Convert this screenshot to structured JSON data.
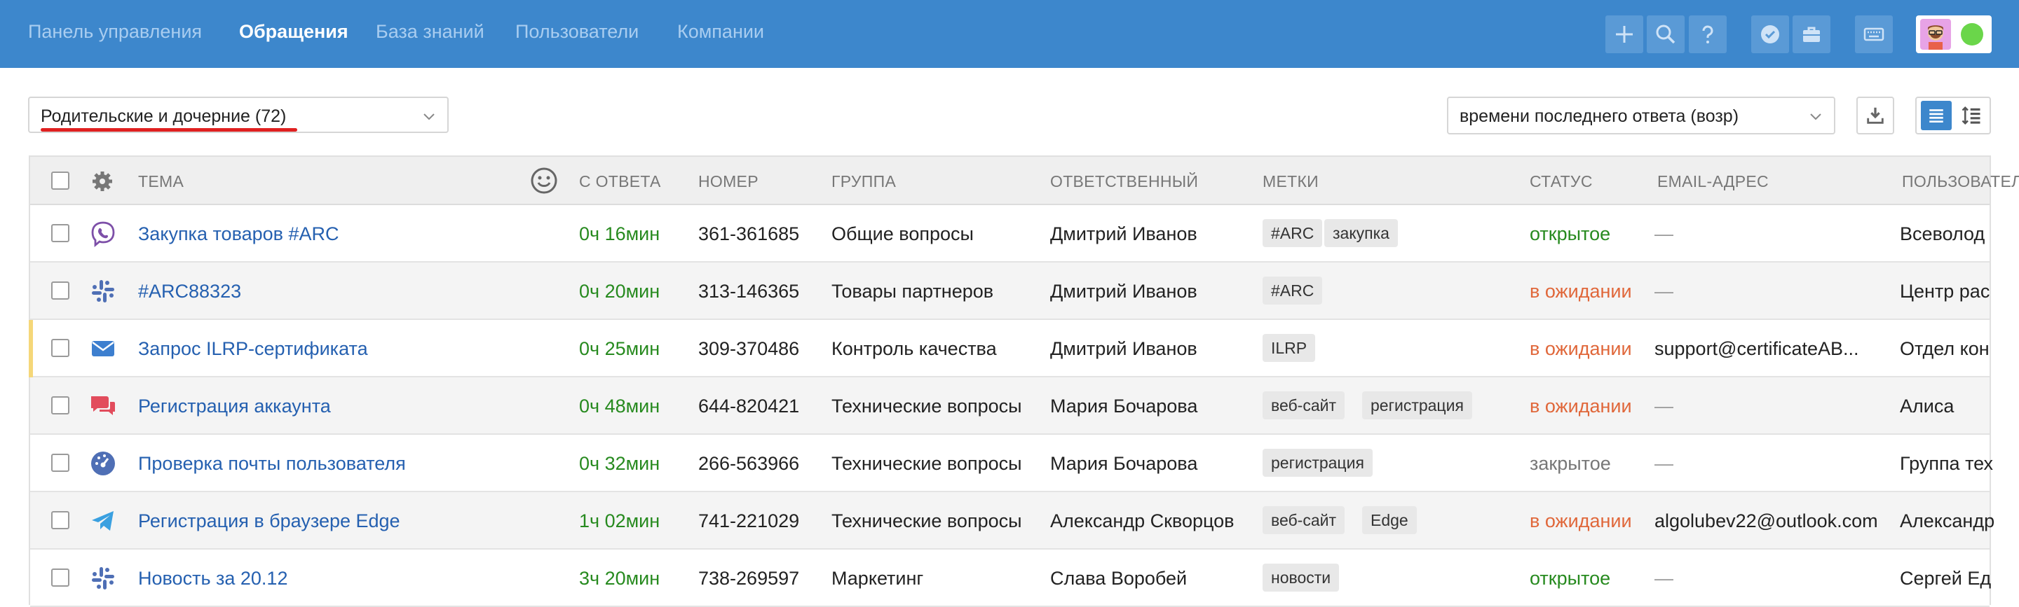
{
  "nav": {
    "items": [
      "Панель управления",
      "Обращения",
      "База знаний",
      "Пользователи",
      "Компании"
    ],
    "active": "Обращения",
    "toolbar_icons": [
      "plus-icon",
      "search-icon",
      "help-icon",
      "check-badge-icon",
      "briefcase-icon",
      "keyboard-icon"
    ]
  },
  "filter": {
    "view_select": "Родительские и дочерние (72)",
    "sort_select": "времени последнего ответа (возр)"
  },
  "table": {
    "headers": {
      "subject": "ТЕМА",
      "since_reply": "С ОТВЕТА",
      "number": "НОМЕР",
      "group": "ГРУППА",
      "assignee": "ОТВЕТСТВЕННЫЙ",
      "tags": "МЕТКИ",
      "status": "СТАТУС",
      "email": "EMAIL-АДРЕС",
      "user": "ПОЛЬЗОВАТЕЛЬ"
    },
    "rows": [
      {
        "channel": "viber-icon",
        "subject": "Закупка товаров #ARC",
        "since_reply": "0ч 16мин",
        "number": "361-361685",
        "group": "Общие вопросы",
        "assignee": "Дмитрий Иванов",
        "tags": [
          "#ARC",
          "закупка"
        ],
        "status": "открытое",
        "status_kind": "open",
        "email": "—",
        "user": "Всеволод"
      },
      {
        "channel": "slack-icon",
        "subject": "#ARC88323",
        "since_reply": "0ч 20мин",
        "number": "313-146365",
        "group": "Товары партнеров",
        "assignee": "Дмитрий Иванов",
        "tags": [
          "#ARC"
        ],
        "status": "в ожидании",
        "status_kind": "wait",
        "email": "—",
        "user": "Центр рас"
      },
      {
        "channel": "email-icon",
        "subject": "Запрос ILRP-сертификата",
        "since_reply": "0ч 25мин",
        "number": "309-370486",
        "group": "Контроль качества",
        "assignee": "Дмитрий Иванов",
        "tags": [
          "ILRP"
        ],
        "status": "в ожидании",
        "status_kind": "wait",
        "email": "support@certificateAB...",
        "user": "Отдел кон"
      },
      {
        "channel": "chat-icon",
        "subject": "Регистрация аккаунта",
        "since_reply": "0ч 48мин",
        "number": "644-820421",
        "group": "Технические вопросы",
        "assignee": "Мария Бочарова",
        "tags": [
          "веб-сайт",
          "регистрация"
        ],
        "status": "в ожидании",
        "status_kind": "wait",
        "email": "—",
        "user": "Алиса"
      },
      {
        "channel": "dashboard-icon",
        "subject": "Проверка почты пользователя",
        "since_reply": "0ч 32мин",
        "number": "266-563966",
        "group": "Технические вопросы",
        "assignee": "Мария Бочарова",
        "tags": [
          "регистрация"
        ],
        "status": "закрытое",
        "status_kind": "closed",
        "email": "—",
        "user": "Группа тех"
      },
      {
        "channel": "telegram-icon",
        "subject": "Регистрация в браузере Edge",
        "since_reply": "1ч 02мин",
        "number": "741-221029",
        "group": "Технические вопросы",
        "assignee": "Александр Скворцов",
        "tags": [
          "веб-сайт",
          "Edge"
        ],
        "status": "в ожидании",
        "status_kind": "wait",
        "email": "algolubev22@outlook.com",
        "user": "Александр"
      },
      {
        "channel": "slack-icon",
        "subject": "Новость за 20.12",
        "since_reply": "3ч 20мин",
        "number": "738-269597",
        "group": "Маркетинг",
        "assignee": "Слава Воробей",
        "tags": [
          "новости"
        ],
        "status": "открытое",
        "status_kind": "open",
        "email": "—",
        "user": "Сергей Ед"
      }
    ]
  }
}
